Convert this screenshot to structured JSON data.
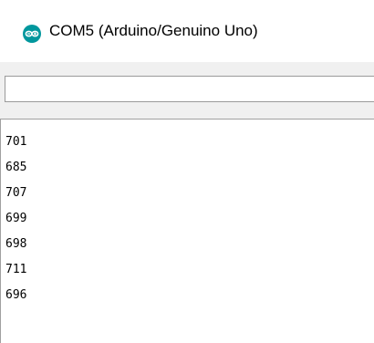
{
  "window": {
    "title": "COM5 (Arduino/Genuino Uno)",
    "icon": "arduino-logo-icon",
    "icon_color": "#00979d"
  },
  "send": {
    "value": ""
  },
  "output": {
    "lines": [
      "701",
      "685",
      "707",
      "699",
      "698",
      "711",
      "696"
    ]
  }
}
